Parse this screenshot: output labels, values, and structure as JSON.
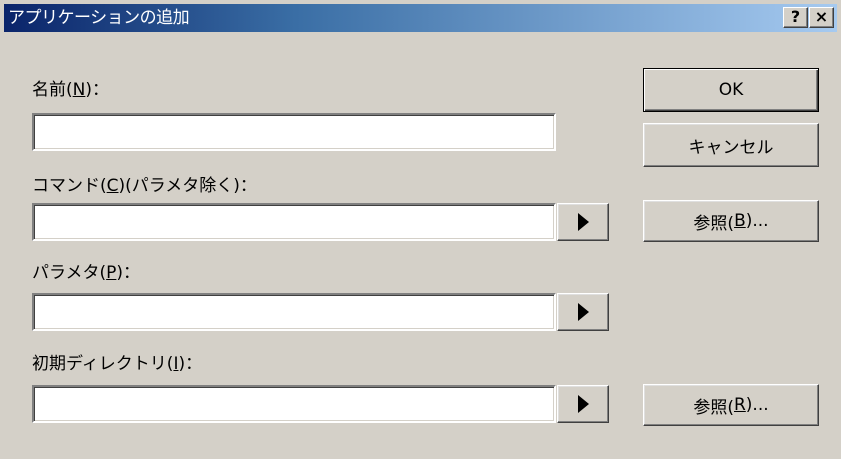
{
  "window": {
    "title": "アプリケーションの追加",
    "help_label": "?",
    "close_label": "×"
  },
  "fields": {
    "name": {
      "label_pre": "名前(",
      "mnemonic": "N",
      "label_post": ")：",
      "value": ""
    },
    "command": {
      "label_pre": "コマンド(",
      "mnemonic": "C",
      "label_post": ")(パラメタ除く)：",
      "value": ""
    },
    "params": {
      "label_pre": "パラメタ(",
      "mnemonic": "P",
      "label_post": ")：",
      "value": ""
    },
    "workdir": {
      "label_pre": "初期ディレクトリ(",
      "mnemonic": "I",
      "label_post": ")：",
      "value": ""
    }
  },
  "buttons": {
    "ok": "OK",
    "cancel": "キャンセル",
    "browse_b_pre": "参照(",
    "browse_b_mn": "B",
    "browse_b_post": ")...",
    "browse_r_pre": "参照(",
    "browse_r_mn": "R",
    "browse_r_post": ")..."
  },
  "icons": {
    "arrow": "right-triangle-icon"
  }
}
